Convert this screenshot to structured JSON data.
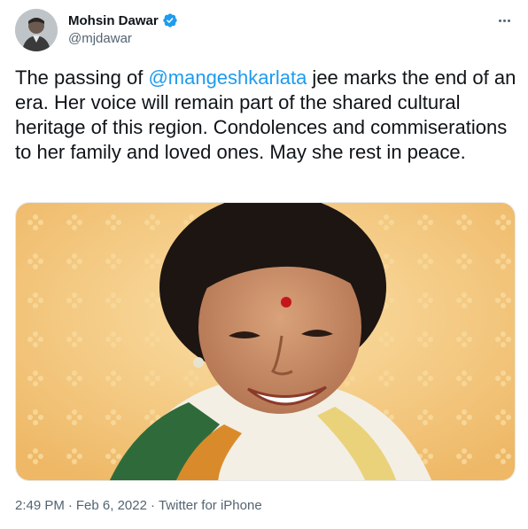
{
  "author": {
    "display_name": "Mohsin Dawar",
    "handle": "@mjdawar",
    "verified": true,
    "verified_color": "#1d9bf0"
  },
  "tweet": {
    "text_before": "The passing of ",
    "mention": "@mangeshkarlata",
    "text_after": " jee marks the end of an era. Her voice will remain part of the shared cultural heritage of this region. Condolences and commiserations to her family and loved ones. May she rest in peace."
  },
  "media": {
    "icon": "photo-portrait",
    "background_color": "#f4c77a"
  },
  "meta": {
    "time": "2:49 PM",
    "separator1": "·",
    "date": "Feb 6, 2022",
    "separator2": "·",
    "source": "Twitter for iPhone"
  },
  "colors": {
    "link": "#1d9bf0",
    "secondary_text": "#536471"
  }
}
